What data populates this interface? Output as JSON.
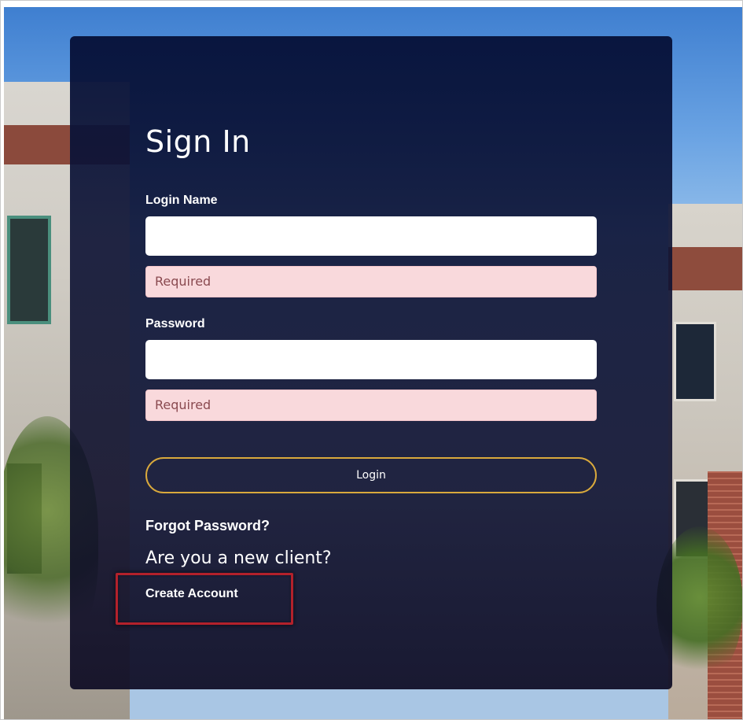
{
  "signin": {
    "title": "Sign In",
    "login_name_label": "Login Name",
    "login_name_value": "",
    "login_name_error": "Required",
    "password_label": "Password",
    "password_value": "",
    "password_error": "Required",
    "login_button_label": "Login",
    "forgot_password_label": "Forgot Password?",
    "new_client_prompt": "Are you a new client?",
    "create_account_label": "Create Account"
  },
  "colors": {
    "panel_bg": "#0c1234",
    "login_button_border": "#d9a93c",
    "error_bg": "#f9d9dc",
    "error_text": "#8a4a50",
    "highlight_border": "#b3212b"
  }
}
